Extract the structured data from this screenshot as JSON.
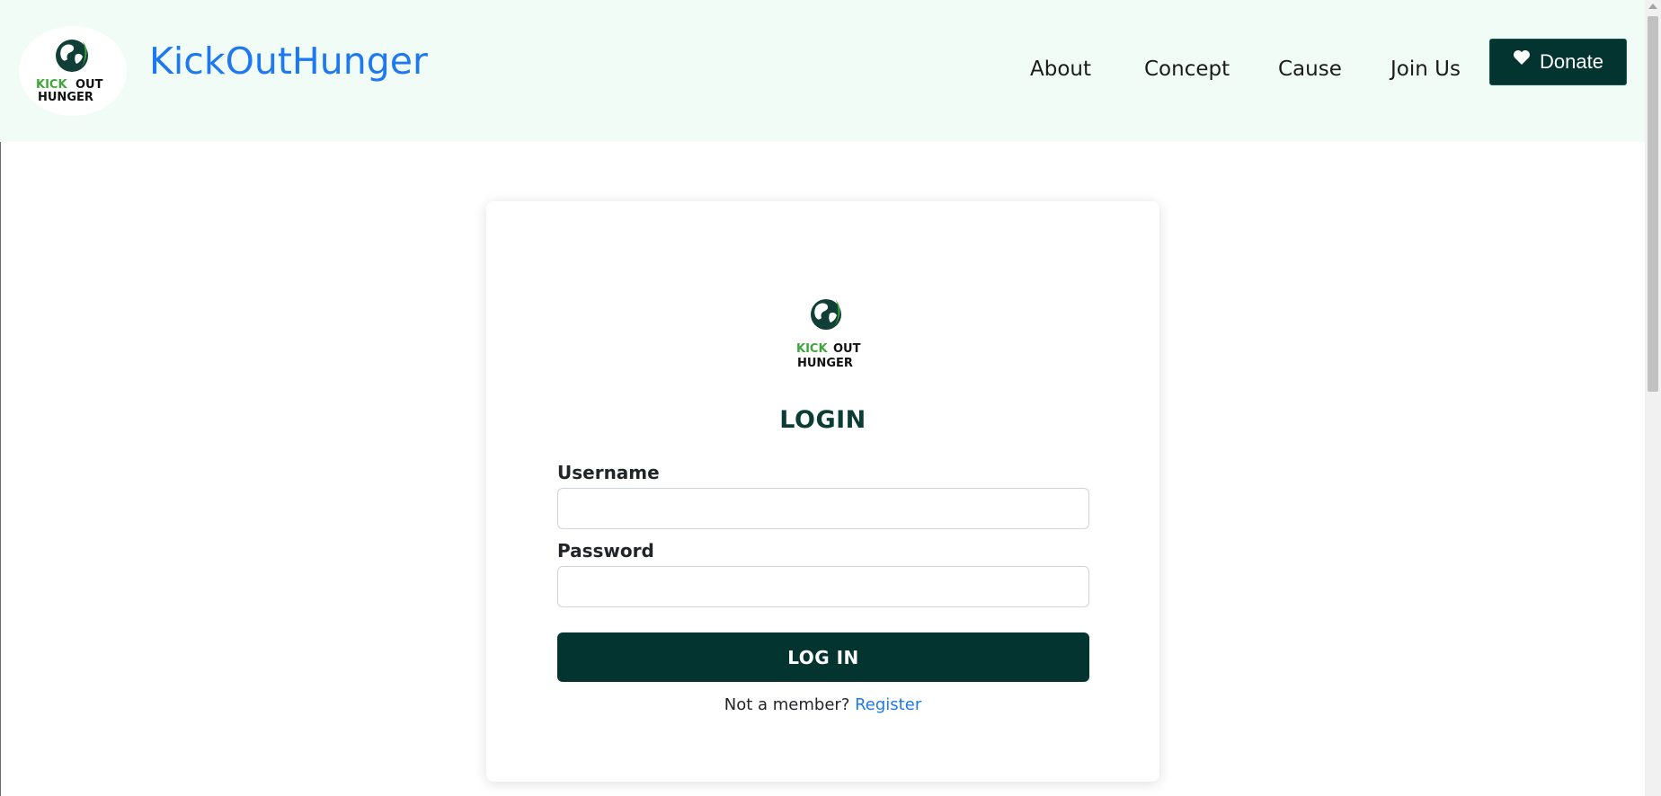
{
  "header": {
    "brand": "KickOutHunger",
    "logo_text": {
      "kick": "KICK",
      "out": "OUT",
      "hunger": "HUNGER"
    },
    "nav": [
      {
        "label": "About"
      },
      {
        "label": "Concept"
      },
      {
        "label": "Cause"
      },
      {
        "label": "Join Us"
      }
    ],
    "donate_label": "Donate",
    "donate_icon": "heart-icon"
  },
  "login": {
    "logo_text": {
      "kick": "KICK",
      "out": "OUT",
      "hunger": "HUNGER"
    },
    "title": "LOGIN",
    "username_label": "Username",
    "username_value": "",
    "password_label": "Password",
    "password_value": "",
    "submit_label": "LOG IN",
    "register_prompt": "Not a member?",
    "register_link": "Register"
  },
  "colors": {
    "header_bg": "#f1fcf6",
    "brand_blue": "#1e78ef",
    "dark_green": "#04342f",
    "logo_green": "#3ea63a"
  }
}
